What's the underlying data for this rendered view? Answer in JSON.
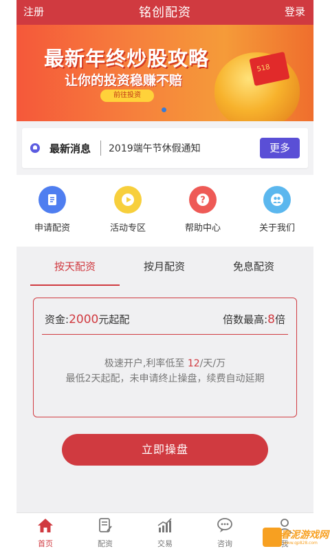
{
  "header": {
    "left": "注册",
    "title": "铭创配资",
    "right": "登录",
    "bg": "#d03a40"
  },
  "banner": {
    "headline": "最新年终炒股攻略",
    "subline": "让你的投资稳赚不赔",
    "button": "前往投资",
    "envelope_text": "518"
  },
  "news": {
    "label": "最新消息",
    "text": "2019端午节休假通知",
    "more": "更多"
  },
  "quick": [
    {
      "label": "申请配资",
      "icon": "document-icon",
      "color": "#4f7ef0"
    },
    {
      "label": "活动专区",
      "icon": "play-icon",
      "color": "#f7cf3c"
    },
    {
      "label": "帮助中心",
      "icon": "question-icon",
      "color": "#ee5a56"
    },
    {
      "label": "关于我们",
      "icon": "people-icon",
      "color": "#5bb7ee"
    }
  ],
  "tabs": [
    "按天配资",
    "按月配资",
    "免息配资"
  ],
  "card": {
    "fund_prefix": "资金:",
    "fund_value": "2000",
    "fund_suffix": "元起配",
    "mult_prefix": "倍数最高:",
    "mult_value": "8",
    "mult_suffix": "倍",
    "desc1_prefix": "极速开户,利率低至",
    "desc1_value": "12",
    "desc1_suffix": "/天/万",
    "desc2": "最低2天起配，未申请终止操盘，续费自动延期"
  },
  "cta": "立即操盘",
  "tabbar": [
    {
      "label": "首页",
      "icon": "home-icon"
    },
    {
      "label": "配资",
      "icon": "edit-document-icon"
    },
    {
      "label": "交易",
      "icon": "chart-icon"
    },
    {
      "label": "咨询",
      "icon": "chat-icon"
    },
    {
      "label": "我",
      "icon": "user-icon"
    }
  ],
  "watermark": {
    "title": "春泥游戏网",
    "url": "www.qp828.com"
  }
}
